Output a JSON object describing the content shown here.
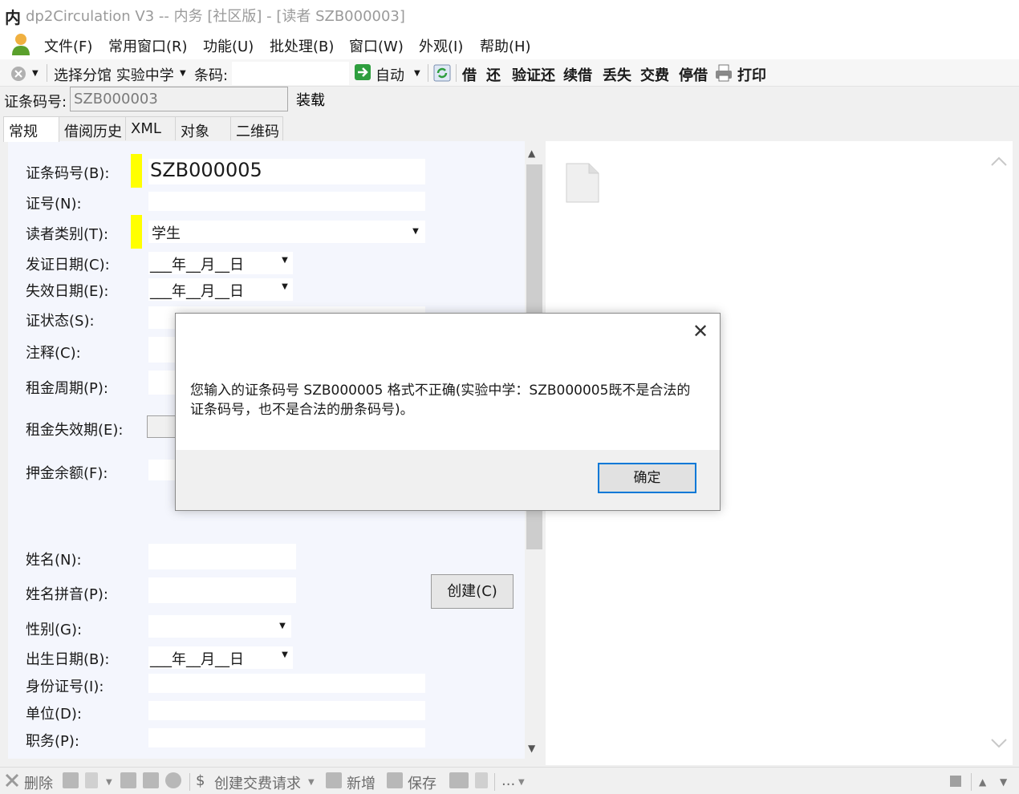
{
  "window": {
    "app_icon": "内",
    "title": "dp2Circulation V3 -- 内务 [社区版] - [读者 SZB000003]"
  },
  "menu": {
    "items": [
      "文件(F)",
      "常用窗口(R)",
      "功能(U)",
      "批处理(B)",
      "窗口(W)",
      "外观(I)",
      "帮助(H)"
    ]
  },
  "toolbar": {
    "library_label": "选择分馆 实验中学",
    "barcode_label": "条码:",
    "barcode_value": "",
    "mode_label": "自动",
    "actions": [
      "借",
      "还",
      "验证还",
      "续借",
      "丢失",
      "交费",
      "停借"
    ],
    "print_label": "打印"
  },
  "card_row": {
    "label": "证条码号:",
    "value": "SZB000003",
    "load_label": "装载"
  },
  "tabs": [
    "常规",
    "借阅历史",
    "XML",
    "对象",
    "二维码"
  ],
  "form": {
    "barcode_label": "证条码号(B):",
    "barcode_value": "SZB000005",
    "cardnumber_label": "证号(N):",
    "type_label": "读者类别(T):",
    "type_value": "学生",
    "create_date_label": "发证日期(C):",
    "create_date_value": "___年__月__日",
    "expire_date_label": "失效日期(E):",
    "expire_date_value": "___年__月__日",
    "state_label": "证状态(S):",
    "comment_label": "注释(C):",
    "rent_period_label": "租金周期(P):",
    "rent_expire_label": "租金失效期(E):",
    "deposit_label": "押金余额(F):",
    "name_label": "姓名(N):",
    "name_pinyin_label": "姓名拼音(P):",
    "create_button": "创建(C)",
    "gender_label": "性别(G):",
    "birth_label": "出生日期(B):",
    "birth_value": "___年__月__日",
    "idcard_label": "身份证号(I):",
    "department_label": "单位(D):",
    "post_label": "职务(P):"
  },
  "bottom_toolbar": {
    "delete_label": "删除",
    "fee_label": "创建交费请求",
    "new_label": "新增",
    "save_label": "保存",
    "more_label": "..."
  },
  "dialog": {
    "close_glyph": "✕",
    "message_line1": "您输入的证条码号 SZB000005 格式不正确(实验中学：SZB000005既不是合法的",
    "message_line2": "证条码号，也不是合法的册条码号)。",
    "ok_label": "确定"
  },
  "colors": {
    "required_marker": "#ffff00",
    "dialog_ok_border": "#0078d7",
    "form_background": "#f4f6fd"
  }
}
